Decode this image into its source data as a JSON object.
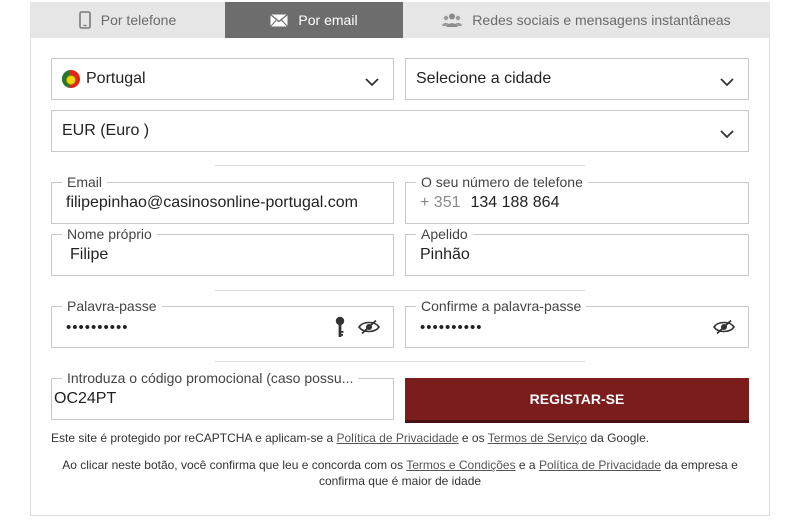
{
  "tabs": [
    {
      "label": "Por telefone",
      "icon": "phone-icon",
      "active": false
    },
    {
      "label": "Por email",
      "icon": "envelope-icon",
      "active": true
    },
    {
      "label": "Redes sociais e mensagens instantâneas",
      "icon": "people-icon",
      "active": false
    }
  ],
  "form": {
    "country": {
      "value": "Portugal",
      "flag": "portugal-flag-icon"
    },
    "city": {
      "placeholder": "Selecione a cidade"
    },
    "currency": {
      "value": "EUR (Euro )"
    },
    "email": {
      "label": "Email",
      "value": "filipepinhao@casinosonline-portugal.com"
    },
    "phone": {
      "label": "O seu número de telefone",
      "prefix": "+ 351",
      "value": "134 188 864"
    },
    "first_name": {
      "label": "Nome próprio",
      "value": "Filipe"
    },
    "last_name": {
      "label": "Apelido",
      "value": "Pinhão"
    },
    "password": {
      "label": "Palavra-passe",
      "value": "••••••••••"
    },
    "confirm_password": {
      "label": "Confirme a palavra-passe",
      "value": "••••••••••"
    },
    "promo": {
      "label": "Introduza o código promocional (caso possu...",
      "value": "OC24PT"
    },
    "register_label": "REGISTAR-SE"
  },
  "recaptcha_note": {
    "pre": "Este site é protegido por reCAPTCHA e aplicam-se a ",
    "privacy_link": "Política de Privacidade",
    "mid": " e os ",
    "terms_link": "Termos de Serviço",
    "post": " da Google."
  },
  "consent_note": {
    "pre": "Ao clicar neste botão, você confirma que leu e concorda com os ",
    "terms_link": "Termos e Condições",
    "mid": " e a ",
    "privacy_link": "Política de Privacidade",
    "post": " da empresa e confirma que é maior de idade"
  },
  "colors": {
    "active_tab": "#6d6d6d",
    "inactive_tab": "#e6e6e6",
    "register_button": "#7b1c1d"
  }
}
